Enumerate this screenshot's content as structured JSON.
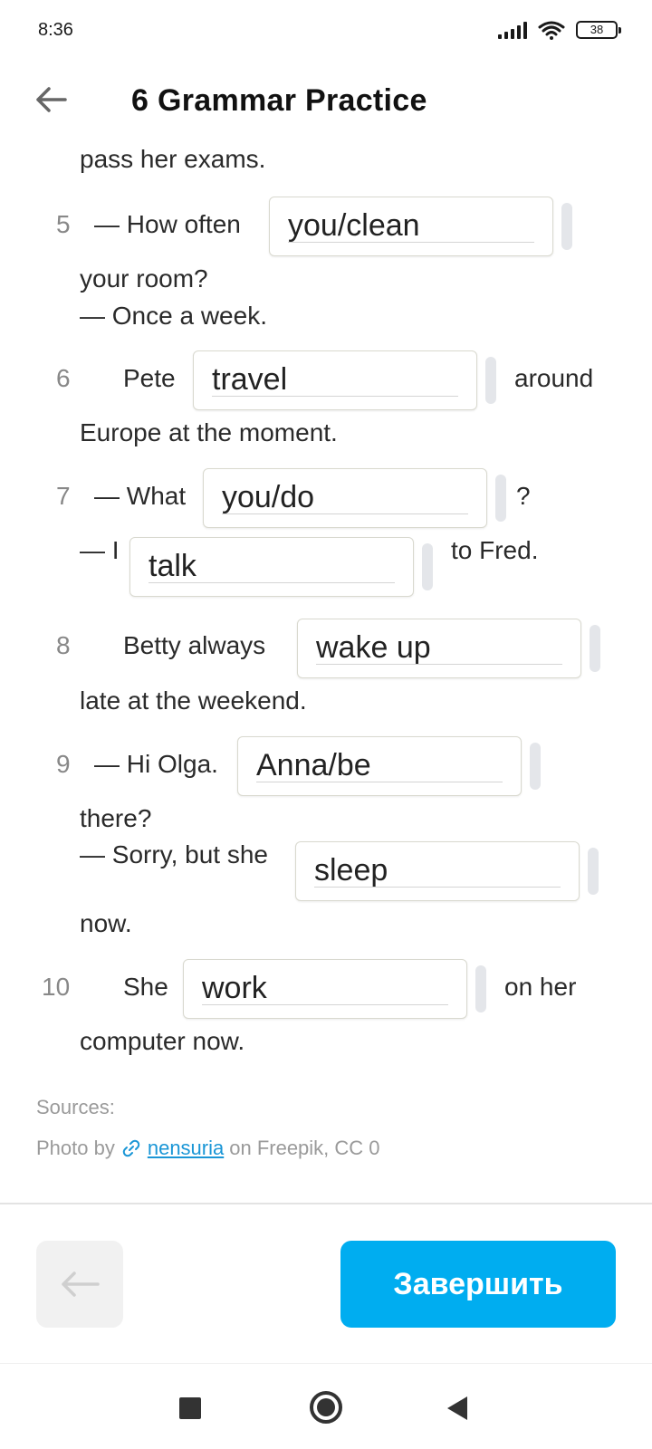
{
  "status": {
    "time": "8:36",
    "battery": "38"
  },
  "header": {
    "title": "6 Grammar Practice"
  },
  "exercise": {
    "line_top": "pass her exams.",
    "items": [
      {
        "num": "5",
        "pre": "— How often",
        "answer": "you/clean",
        "after": "your room?",
        "reply": "— Once a week."
      },
      {
        "num": "6",
        "pre": "Pete",
        "answer": "travel",
        "post": "around",
        "after": "Europe at the moment."
      },
      {
        "num": "7",
        "pre": "— What",
        "answer": "you/do",
        "post": "?",
        "reply_pre": "— I",
        "answer2": "talk",
        "reply_post": "to Fred."
      },
      {
        "num": "8",
        "pre": "Betty always",
        "answer": "wake up",
        "after": "late at the weekend."
      },
      {
        "num": "9",
        "pre": "— Hi Olga.",
        "answer": "Anna/be",
        "after": "there?",
        "reply_pre": "— Sorry, but she",
        "answer2": "sleep",
        "after2": "now."
      },
      {
        "num": "10",
        "pre": "She",
        "answer": "work",
        "post": "on her",
        "after": "computer now."
      }
    ]
  },
  "sources": {
    "label": "Sources:",
    "prefix": "Photo by",
    "link": "nensuria",
    "suffix": "on Freepik, CC 0"
  },
  "footer": {
    "finish_label": "Завершить"
  },
  "icons": {
    "back": "arrow-left-icon",
    "link": "link-icon"
  },
  "colors": {
    "accent": "#00adf0",
    "link": "#1a96d6"
  }
}
